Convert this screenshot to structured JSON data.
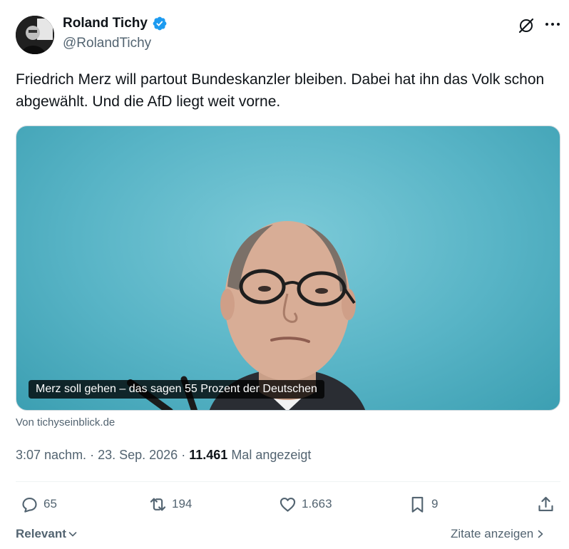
{
  "author": {
    "name": "Roland Tichy",
    "handle": "@RolandTichy",
    "verified_icon": "verified-badge-icon"
  },
  "header_icons": [
    "grok-icon",
    "more-options-icon"
  ],
  "tweet": {
    "text": "Friedrich Merz will partout Bundeskanzler bleiben. Dabei hat ihn das Volk schon abgewählt. Und die AfD liegt weit vorne.",
    "media_caption": "Merz soll gehen – das sagen 55 Prozent der Deutschen",
    "link_source": "Von tichyseinblick.de"
  },
  "meta": {
    "time": "3:07 nachm.",
    "separator": "·",
    "date": "23. Sep. 2026",
    "views_count": "11.461",
    "views_label": "Mal angezeigt"
  },
  "actions": {
    "replies": "65",
    "reposts": "194",
    "likes": "1.663",
    "bookmarks": "9"
  },
  "footer": {
    "sort_label": "Relevant",
    "quotes_label": "Zitate anzeigen"
  },
  "colors": {
    "accent": "#1d9bf0",
    "secondary_text": "#536471",
    "photo_background": "#5fb8c9"
  }
}
